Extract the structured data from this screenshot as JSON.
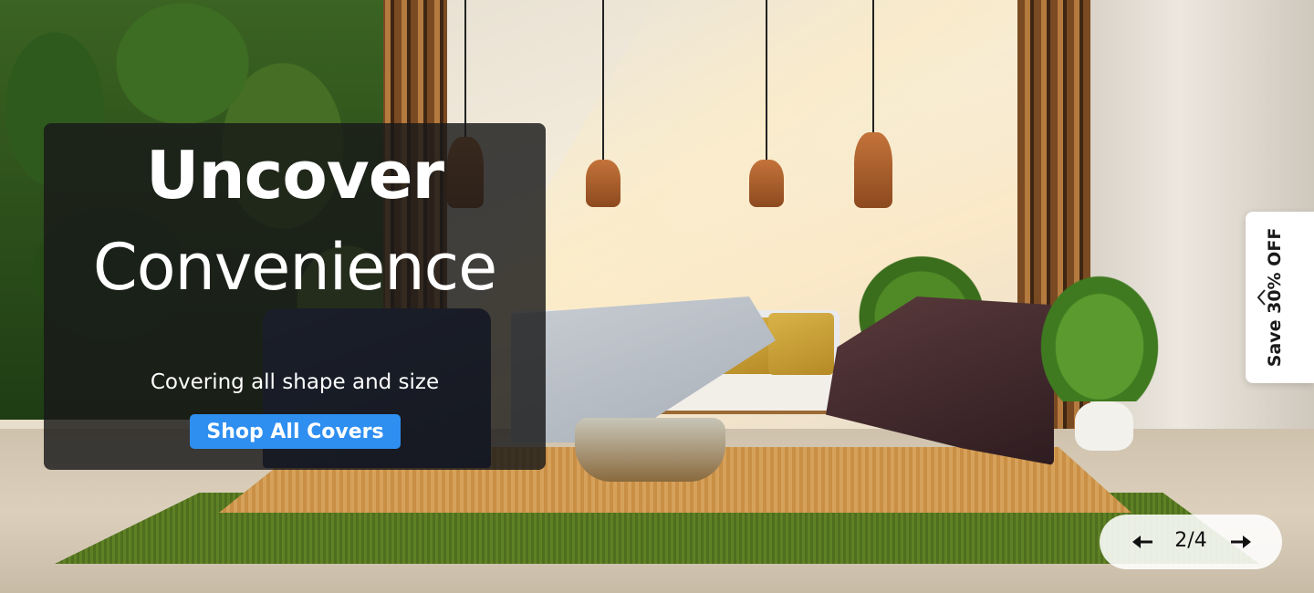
{
  "hero": {
    "headline_line1": "Uncover",
    "headline_line2": "Convenience",
    "subtitle": "Covering all shape and size",
    "cta_label": "Shop All Covers",
    "accent_color": "#2f8ff0"
  },
  "promo_tab": {
    "label": "Save 30% OFF",
    "icon": "chevron-left-icon"
  },
  "carousel": {
    "current": 2,
    "total": 4,
    "counter_text": "2/4",
    "prev_icon": "arrow-left-icon",
    "next_icon": "arrow-right-icon"
  }
}
